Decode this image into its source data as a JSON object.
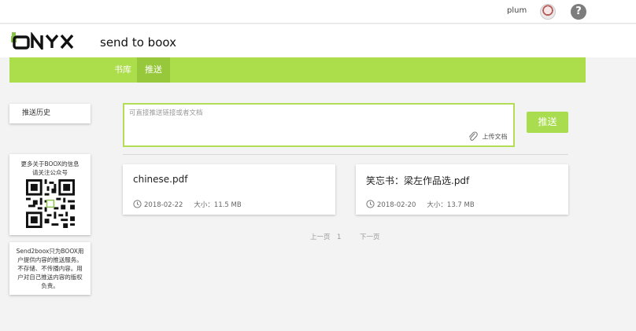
{
  "topbar": {
    "username": "plum",
    "help_glyph": "?"
  },
  "header": {
    "logo_text": "ONYX",
    "title": "send to boox"
  },
  "nav": {
    "items": [
      {
        "label": "书库"
      },
      {
        "label": "推送"
      }
    ],
    "active": "推送"
  },
  "sidebar": {
    "history_label": "推送历史",
    "qr_line1": "更多关于BOOX的信息",
    "qr_line2": "请关注公众号",
    "notice": "Send2boox只为BOOX用户提供内容的推送服务。不存储、不传播内容。用户对自己推送内容的版权负责。"
  },
  "push": {
    "placeholder": "可直接推送链接或者文档",
    "upload_label": "上传文档",
    "button_label": "推送"
  },
  "files": [
    {
      "name": "chinese.pdf",
      "date": "2018-02-22",
      "size_label": "大小：11.5 MB"
    },
    {
      "name": "笑忘书：梁左作品选.pdf",
      "date": "2018-02-20",
      "size_label": "大小：13.7 MB"
    }
  ],
  "pagination": {
    "prev": "上一页",
    "current": "1",
    "next": "下一页"
  },
  "colors": {
    "accent": "#acdd4a",
    "accent_dark": "#97c73a",
    "border": "#b3dd57"
  }
}
